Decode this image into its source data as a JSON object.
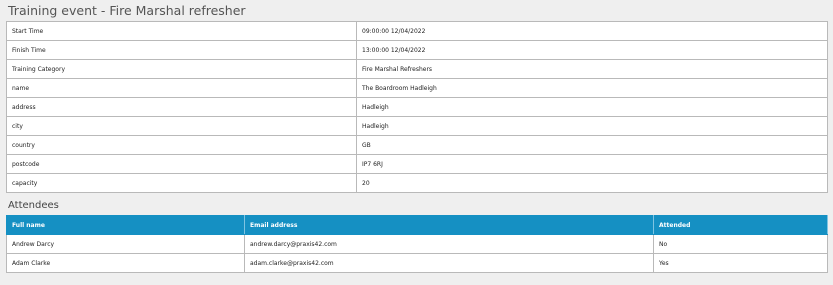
{
  "page_title": "Training event - Fire Marshal refresher",
  "details": [
    {
      "label": "Start Time",
      "value": "09:00:00 12/04/2022"
    },
    {
      "label": "Finish Time",
      "value": "13:00:00 12/04/2022"
    },
    {
      "label": "Training Category",
      "value": "Fire Marshal Refreshers"
    },
    {
      "label": "name",
      "value": "The Boardroom Hadleigh"
    },
    {
      "label": "address",
      "value": "Hadleigh"
    },
    {
      "label": "city",
      "value": "Hadleigh"
    },
    {
      "label": "country",
      "value": "GB"
    },
    {
      "label": "postcode",
      "value": "IP7 6RJ"
    },
    {
      "label": "capacity",
      "value": "20"
    }
  ],
  "attendees_title": "Attendees",
  "attendees": {
    "headers": [
      "Full name",
      "Email address",
      "Attended"
    ],
    "rows": [
      [
        "Andrew Darcy",
        "andrew.darcy@praxis42.com",
        "No"
      ],
      [
        "Adam Clarke",
        "adam.clarke@praxis42.com",
        "Yes"
      ]
    ]
  },
  "colors": {
    "header_bg": "#1590c3",
    "page_bg": "#efefef"
  }
}
